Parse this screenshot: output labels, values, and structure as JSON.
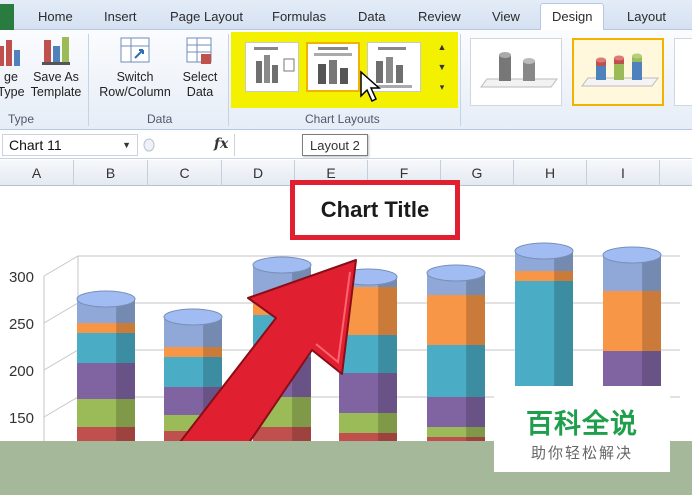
{
  "ribbon_tabs": [
    "Home",
    "Insert",
    "Page Layout",
    "Formulas",
    "Data",
    "Review",
    "View",
    "Design",
    "Layout"
  ],
  "active_tab": "Design",
  "ribbon": {
    "change_type_line1": "ge",
    "change_type_line2": "Type",
    "save_template_line1": "Save As",
    "save_template_line2": "Template",
    "switch_line1": "Switch",
    "switch_line2": "Row/Column",
    "select_line1": "Select",
    "select_line2": "Data",
    "group_type": "Type",
    "group_data": "Data",
    "group_layouts": "Chart Layouts",
    "highlight_color": "#f3f000"
  },
  "formula_bar": {
    "name_box": "Chart 11",
    "fx_label": "fx",
    "tooltip": "Layout 2"
  },
  "columns": [
    "A",
    "B",
    "C",
    "D",
    "E",
    "F",
    "G",
    "H",
    "I"
  ],
  "chart": {
    "title": "Chart Title",
    "y_ticks": [
      "300",
      "250",
      "200",
      "150"
    ]
  },
  "chart_data": {
    "type": "bar",
    "style": "stacked 3D cylinder",
    "y_tick_labels": [
      300,
      250,
      200,
      150
    ],
    "series_colors": [
      "#c0504d",
      "#9bbb59",
      "#8064a2",
      "#4bacc6",
      "#f79646",
      "#8fa8d8"
    ]
  },
  "annotation": {
    "arrow_color": "#e02030",
    "box_color": "#e02030"
  },
  "watermark": {
    "name": "百科全说",
    "sub": "助你轻松解决",
    "color": "#1f9e4c"
  }
}
